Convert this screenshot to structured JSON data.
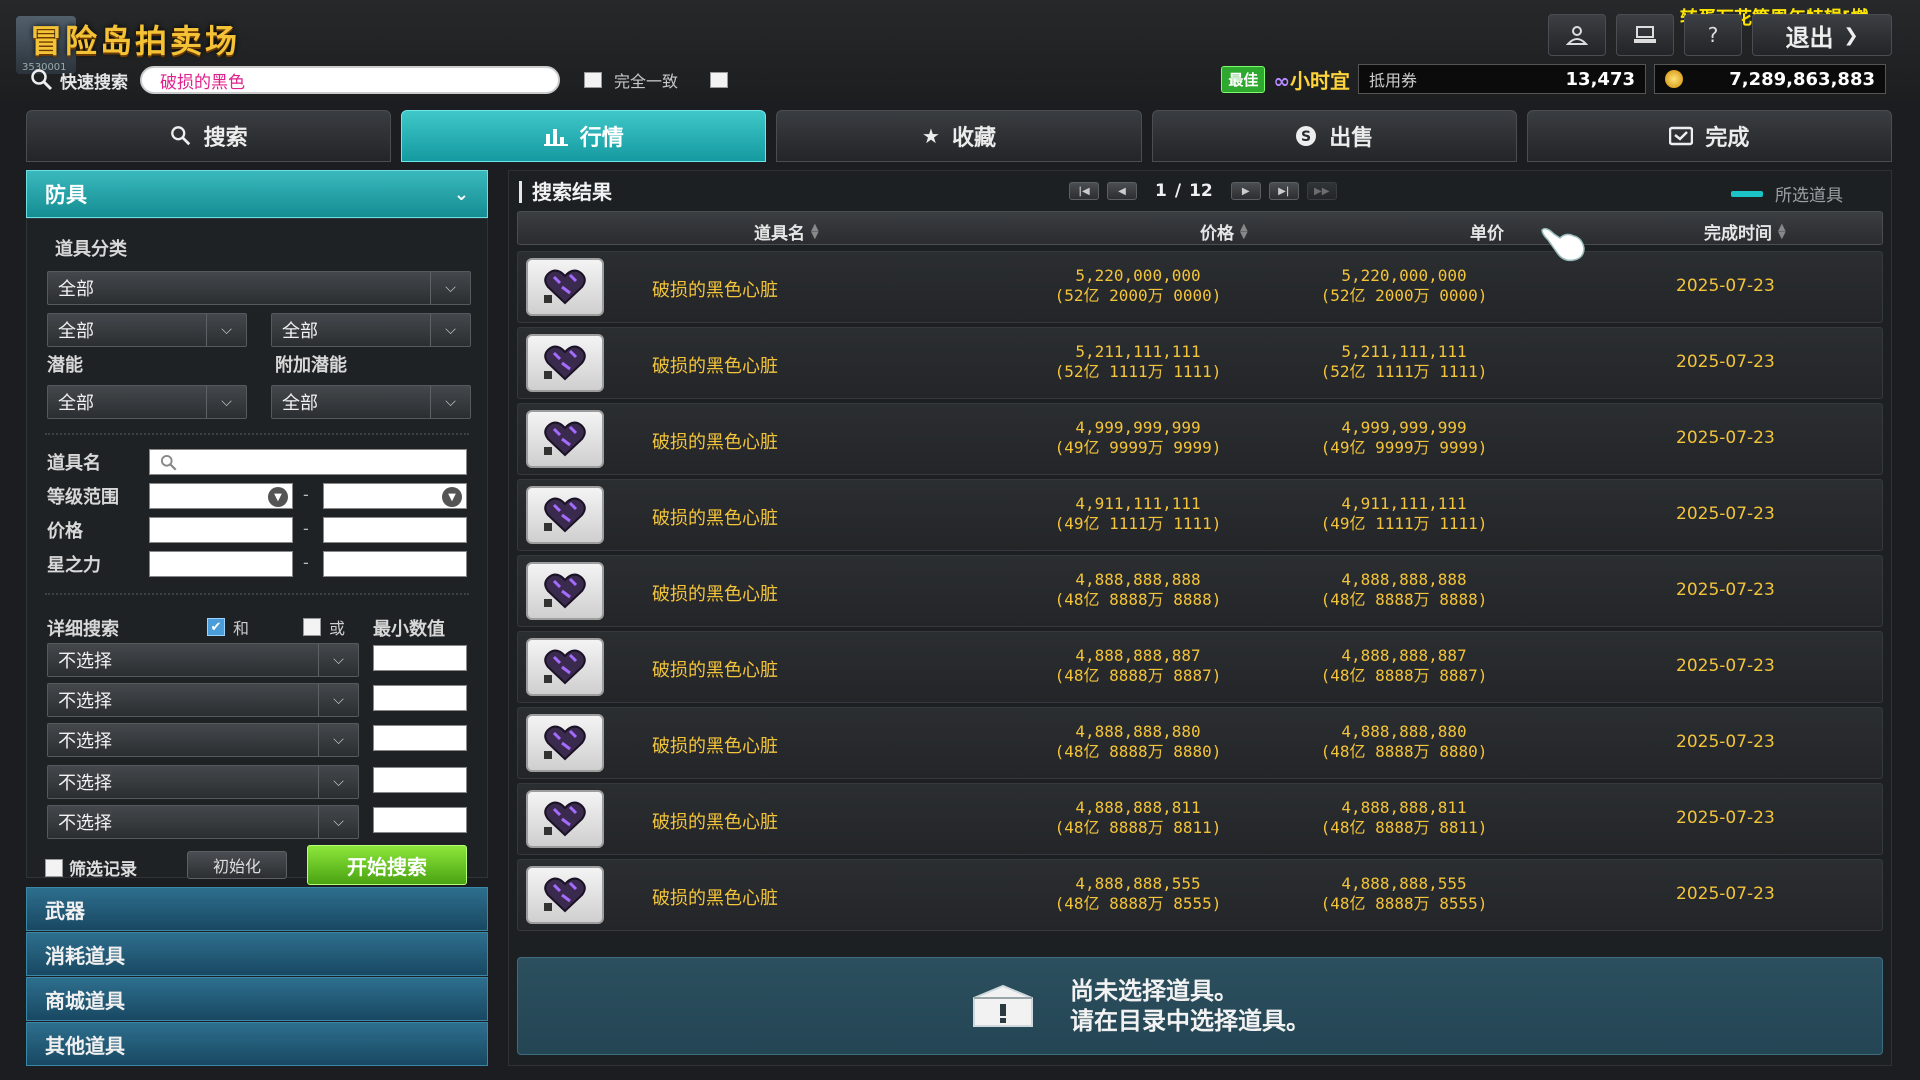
{
  "header": {
    "title": "冒险岛拍卖场",
    "logo_caption": "3530001",
    "marquee": "转蛋万花筒周年特辑[燃",
    "logout_label": "退出"
  },
  "quick_search": {
    "label": "快速搜索",
    "value": "破损的黑色",
    "exact_label": "完全一致"
  },
  "wallet": {
    "best_badge": "最佳",
    "brand": "小时宜",
    "voucher_label": "抵用券",
    "voucher_value": "13,473",
    "mesos_value": "7,289,863,883"
  },
  "tabs": [
    {
      "label": "搜索",
      "icon": "search-icon",
      "active": false
    },
    {
      "label": "行情",
      "icon": "chart-icon",
      "active": true
    },
    {
      "label": "收藏",
      "icon": "star-icon",
      "active": false
    },
    {
      "label": "出售",
      "icon": "coin-s-icon",
      "active": false
    },
    {
      "label": "完成",
      "icon": "check-mail-icon",
      "active": false
    }
  ],
  "left": {
    "category": "防具",
    "item_class_label": "道具分类",
    "dd_all_1": "全部",
    "dd_all_2": "全部",
    "dd_all_3": "全部",
    "potential_label": "潜能",
    "extra_potential_label": "附加潜能",
    "dd_potential": "全部",
    "dd_extra_potential": "全部",
    "item_name_label": "道具名",
    "level_range_label": "等级范围",
    "price_label": "价格",
    "starforce_label": "星之力",
    "dash": "-",
    "detail_search_label": "详细搜索",
    "and_label": "和",
    "or_label": "或",
    "min_value_label": "最小数值",
    "detail_options": [
      "不选择",
      "不选择",
      "不选择",
      "不选择",
      "不选择"
    ],
    "filter_record_label": "筛选记录",
    "init_label": "初始化",
    "search_label": "开始搜索",
    "other_categories": [
      "武器",
      "消耗道具",
      "商城道具",
      "其他道具"
    ]
  },
  "results": {
    "title": "搜索结果",
    "page_current": "1",
    "page_sep": "/",
    "page_total": "12",
    "selected_label": "所选道具",
    "columns": {
      "name": "道具名",
      "price": "价格",
      "unit_price": "单价",
      "time": "完成时间"
    },
    "rows": [
      {
        "name": "破损的黑色心脏",
        "price": "5,220,000,000",
        "price_cn": "(52亿 2000万 0000)",
        "unit": "5,220,000,000",
        "unit_cn": "(52亿 2000万 0000)",
        "date": "2025-07-23"
      },
      {
        "name": "破损的黑色心脏",
        "price": "5,211,111,111",
        "price_cn": "(52亿 1111万 1111)",
        "unit": "5,211,111,111",
        "unit_cn": "(52亿 1111万 1111)",
        "date": "2025-07-23"
      },
      {
        "name": "破损的黑色心脏",
        "price": "4,999,999,999",
        "price_cn": "(49亿 9999万 9999)",
        "unit": "4,999,999,999",
        "unit_cn": "(49亿 9999万 9999)",
        "date": "2025-07-23"
      },
      {
        "name": "破损的黑色心脏",
        "price": "4,911,111,111",
        "price_cn": "(49亿 1111万 1111)",
        "unit": "4,911,111,111",
        "unit_cn": "(49亿 1111万 1111)",
        "date": "2025-07-23"
      },
      {
        "name": "破损的黑色心脏",
        "price": "4,888,888,888",
        "price_cn": "(48亿 8888万 8888)",
        "unit": "4,888,888,888",
        "unit_cn": "(48亿 8888万 8888)",
        "date": "2025-07-23"
      },
      {
        "name": "破损的黑色心脏",
        "price": "4,888,888,887",
        "price_cn": "(48亿 8888万 8887)",
        "unit": "4,888,888,887",
        "unit_cn": "(48亿 8888万 8887)",
        "date": "2025-07-23"
      },
      {
        "name": "破损的黑色心脏",
        "price": "4,888,888,880",
        "price_cn": "(48亿 8888万 8880)",
        "unit": "4,888,888,880",
        "unit_cn": "(48亿 8888万 8880)",
        "date": "2025-07-23"
      },
      {
        "name": "破损的黑色心脏",
        "price": "4,888,888,811",
        "price_cn": "(48亿 8888万 8811)",
        "unit": "4,888,888,811",
        "unit_cn": "(48亿 8888万 8811)",
        "date": "2025-07-23"
      },
      {
        "name": "破损的黑色心脏",
        "price": "4,888,888,555",
        "price_cn": "(48亿 8888万 8555)",
        "unit": "4,888,888,555",
        "unit_cn": "(48亿 8888万 8555)",
        "date": "2025-07-23"
      }
    ],
    "empty_line1": "尚未选择道具。",
    "empty_line2": "请在目录中选择道具。"
  },
  "colors": {
    "accent": "#1bc3c7",
    "gold_text": "#f3c33a",
    "search_green": "#6ccd28"
  }
}
